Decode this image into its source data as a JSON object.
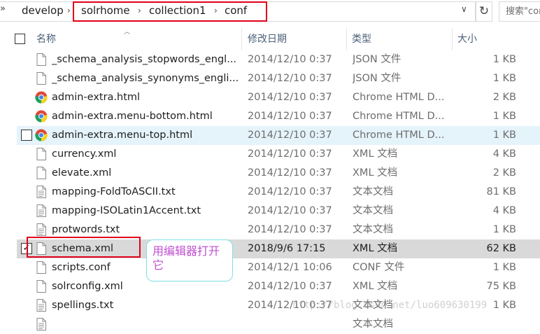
{
  "address_bar": {
    "overflow_glyph": "»",
    "segments": [
      "develop",
      "solrhome",
      "collection1",
      "conf"
    ],
    "search_placeholder": "搜索\"conf\""
  },
  "columns": {
    "name": "名称",
    "date": "修改日期",
    "type": "类型",
    "size": "大小"
  },
  "files": [
    {
      "name": "_schema_analysis_stopwords_engl...",
      "date": "2014/12/10 0:37",
      "type": "JSON 文件",
      "size": "1 KB",
      "icon": "file-icon"
    },
    {
      "name": "_schema_analysis_synonyms_engli...",
      "date": "2014/12/10 0:37",
      "type": "JSON 文件",
      "size": "1 KB",
      "icon": "file-icon"
    },
    {
      "name": "admin-extra.html",
      "date": "2014/12/10 0:37",
      "type": "Chrome HTML D...",
      "size": "2 KB",
      "icon": "chrome-icon"
    },
    {
      "name": "admin-extra.menu-bottom.html",
      "date": "2014/12/10 0:37",
      "type": "Chrome HTML D...",
      "size": "1 KB",
      "icon": "chrome-icon"
    },
    {
      "name": "admin-extra.menu-top.html",
      "date": "2014/12/10 0:37",
      "type": "Chrome HTML D...",
      "size": "1 KB",
      "icon": "chrome-icon"
    },
    {
      "name": "currency.xml",
      "date": "2014/12/10 0:37",
      "type": "XML 文档",
      "size": "4 KB",
      "icon": "file-icon"
    },
    {
      "name": "elevate.xml",
      "date": "2014/12/10 0:37",
      "type": "XML 文档",
      "size": "2 KB",
      "icon": "file-icon"
    },
    {
      "name": "mapping-FoldToASCII.txt",
      "date": "2014/12/10 0:37",
      "type": "文本文档",
      "size": "81 KB",
      "icon": "text-file-icon"
    },
    {
      "name": "mapping-ISOLatin1Accent.txt",
      "date": "2014/12/10 0:37",
      "type": "文本文档",
      "size": "4 KB",
      "icon": "text-file-icon"
    },
    {
      "name": "protwords.txt",
      "date": "2014/12/10 0:37",
      "type": "文本文档",
      "size": "1 KB",
      "icon": "text-file-icon"
    },
    {
      "name": "schema.xml",
      "date": "2018/9/6 17:15",
      "type": "XML 文档",
      "size": "62 KB",
      "icon": "file-icon"
    },
    {
      "name": "scripts.conf",
      "date": "2014/12/1 10:06",
      "type": "CONF 文件",
      "size": "1 KB",
      "icon": "file-icon"
    },
    {
      "name": "solrconfig.xml",
      "date": "2014/12/10 0:37",
      "type": "XML 文档",
      "size": "75 KB",
      "icon": "file-icon"
    },
    {
      "name": "spellings.txt",
      "date": "2014/12/10 0:37",
      "type": "文本文档",
      "size": "1 KB",
      "icon": "text-file-icon"
    },
    {
      "name": "",
      "date": "",
      "type": "文本文档",
      "size": "",
      "icon": "text-file-icon"
    }
  ],
  "hover_row": 4,
  "selected_row": 10,
  "annotation": {
    "callout_text": "用编辑器打开它"
  },
  "watermark": "http://blog.csdn.net/luo609630199",
  "colors": {
    "highlight_red": "#e0001a",
    "callout_text": "#c04fd1",
    "callout_border": "#7fe0e4",
    "hover_bg": "#e5f3fb",
    "selected_bg": "#d9d9d9"
  }
}
